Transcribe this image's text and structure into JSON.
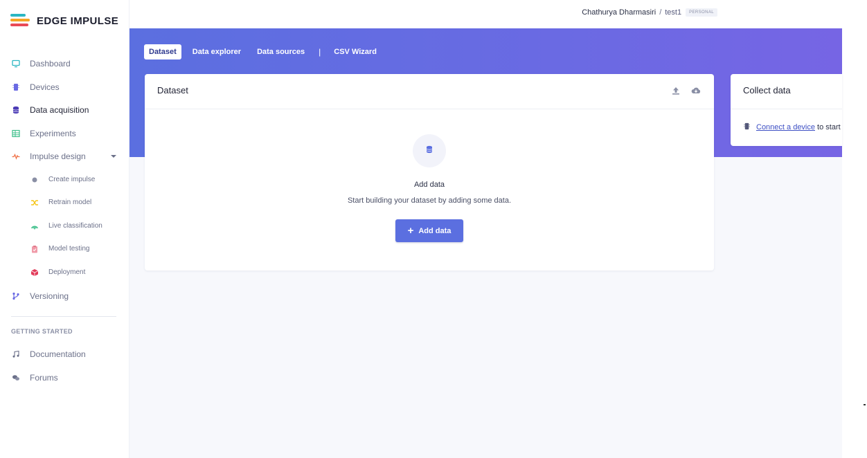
{
  "brand": {
    "name": "EDGE IMPULSE",
    "colors": {
      "teal": "#2bb6c2",
      "orange": "#f5a623",
      "red": "#e94b56",
      "accent": "#5b6fe0"
    }
  },
  "sidebar": {
    "items": [
      {
        "id": "dashboard",
        "label": "Dashboard",
        "icon": "monitor-icon",
        "color": "#2bb6c2"
      },
      {
        "id": "devices",
        "label": "Devices",
        "icon": "chip-icon",
        "color": "#6a6ae3"
      },
      {
        "id": "data-acquisition",
        "label": "Data acquisition",
        "icon": "database-icon",
        "color": "#4b3bb5",
        "active": true
      },
      {
        "id": "experiments",
        "label": "Experiments",
        "icon": "table-icon",
        "color": "#3cbf8a"
      },
      {
        "id": "impulse-design",
        "label": "Impulse design",
        "icon": "pulse-icon",
        "color": "#f0734a",
        "expandable": true
      }
    ],
    "subitems": [
      {
        "id": "create-impulse",
        "label": "Create impulse",
        "icon": "dot-icon",
        "color": "#8a8fa5"
      },
      {
        "id": "retrain-model",
        "label": "Retrain model",
        "icon": "shuffle-icon",
        "color": "#f5c518"
      },
      {
        "id": "live-classification",
        "label": "Live classification",
        "icon": "signal-icon",
        "color": "#3cbf8a"
      },
      {
        "id": "model-testing",
        "label": "Model testing",
        "icon": "clipboard-icon",
        "color": "#f09aa8"
      },
      {
        "id": "deployment",
        "label": "Deployment",
        "icon": "cube-icon",
        "color": "#e23b5a"
      }
    ],
    "versioning": {
      "label": "Versioning",
      "icon": "branch-icon",
      "color": "#6a6ae3"
    },
    "getting_started": {
      "title": "GETTING STARTED",
      "items": [
        {
          "id": "documentation",
          "label": "Documentation",
          "icon": "music-book-icon"
        },
        {
          "id": "forums",
          "label": "Forums",
          "icon": "chat-icon"
        }
      ]
    }
  },
  "header": {
    "user_name": "Chathurya Dharmasiri",
    "separator": "/",
    "project": "test1",
    "badge": "PERSONAL"
  },
  "tabs": [
    {
      "label": "Dataset",
      "active": true
    },
    {
      "label": "Data explorer"
    },
    {
      "label": "Data sources"
    },
    {
      "label": "CSV Wizard"
    }
  ],
  "tab_divider": "|",
  "dataset_card": {
    "title": "Dataset",
    "empty_title": "Add data",
    "empty_subtitle": "Start building your dataset by adding some data.",
    "add_button": "Add data"
  },
  "collect_card": {
    "title": "Collect data",
    "link_text": "Connect a device",
    "suffix": " to start"
  }
}
